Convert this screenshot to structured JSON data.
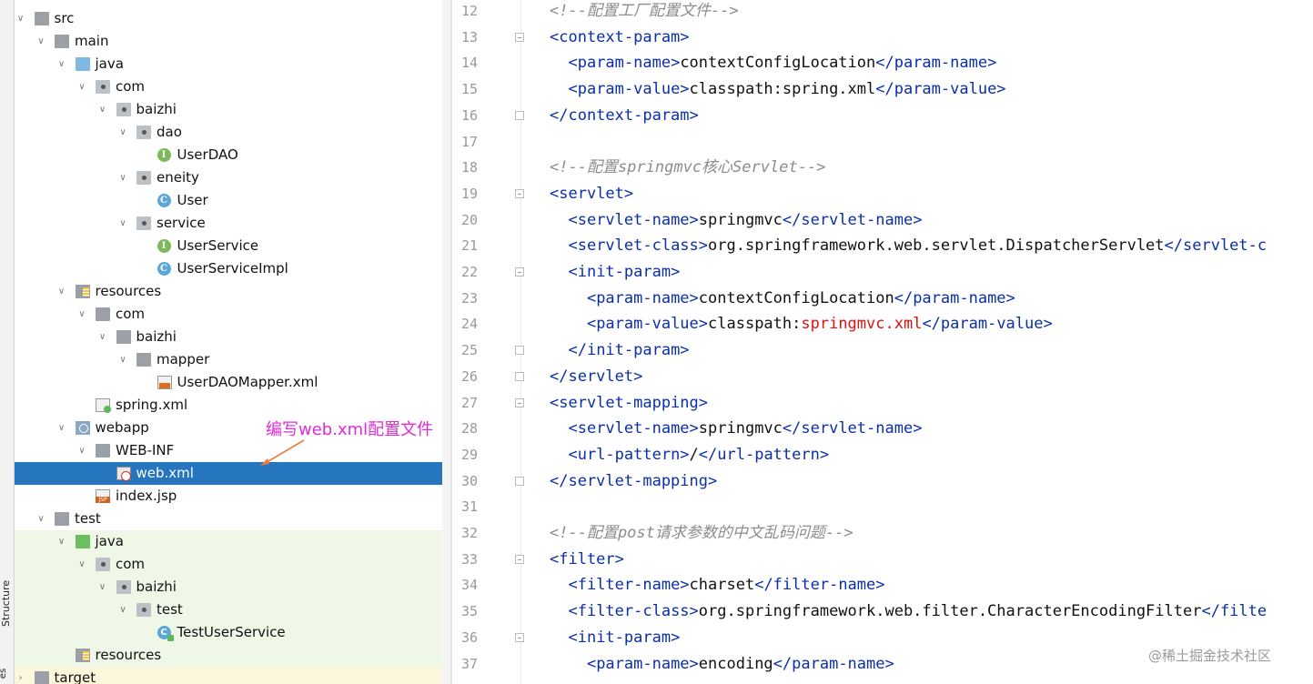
{
  "sidebar": {
    "structure_tab": "Structure",
    "bottom_tab": "es"
  },
  "tree": [
    {
      "label": "src",
      "icon": "folder-icon"
    },
    {
      "label": "main",
      "icon": "folder-icon"
    },
    {
      "label": "java",
      "icon": "source-folder-icon"
    },
    {
      "label": "com",
      "icon": "package-icon"
    },
    {
      "label": "baizhi",
      "icon": "package-icon"
    },
    {
      "label": "dao",
      "icon": "package-icon"
    },
    {
      "label": "UserDAO",
      "icon": "interface-icon"
    },
    {
      "label": "eneity",
      "icon": "package-icon"
    },
    {
      "label": "User",
      "icon": "class-icon"
    },
    {
      "label": "service",
      "icon": "package-icon"
    },
    {
      "label": "UserService",
      "icon": "interface-icon"
    },
    {
      "label": "UserServiceImpl",
      "icon": "class-icon"
    },
    {
      "label": "resources",
      "icon": "resources-folder-icon"
    },
    {
      "label": "com",
      "icon": "folder-icon"
    },
    {
      "label": "baizhi",
      "icon": "folder-icon"
    },
    {
      "label": "mapper",
      "icon": "folder-icon"
    },
    {
      "label": "UserDAOMapper.xml",
      "icon": "xml-file-icon"
    },
    {
      "label": "spring.xml",
      "icon": "spring-xml-icon"
    },
    {
      "label": "webapp",
      "icon": "web-folder-icon"
    },
    {
      "label": "WEB-INF",
      "icon": "folder-icon"
    },
    {
      "label": "web.xml",
      "icon": "web-xml-icon"
    },
    {
      "label": "index.jsp",
      "icon": "jsp-file-icon"
    },
    {
      "label": "test",
      "icon": "folder-icon"
    },
    {
      "label": "java",
      "icon": "test-source-folder-icon"
    },
    {
      "label": "com",
      "icon": "package-icon"
    },
    {
      "label": "baizhi",
      "icon": "package-icon"
    },
    {
      "label": "test",
      "icon": "package-icon"
    },
    {
      "label": "TestUserService",
      "icon": "test-class-icon"
    },
    {
      "label": "resources",
      "icon": "resources-folder-icon"
    },
    {
      "label": "target",
      "icon": "excluded-folder-icon"
    }
  ],
  "annotation": {
    "text": "编写web.xml配置文件",
    "color": "#e22bd7"
  },
  "editor": {
    "lines": [
      {
        "n": "12",
        "segs": [
          {
            "t": "<!--配置工厂配置文件-->",
            "c": "cm"
          }
        ]
      },
      {
        "n": "13",
        "segs": [
          {
            "t": "<context-param>",
            "c": "tg"
          }
        ]
      },
      {
        "n": "14",
        "segs": [
          {
            "t": "  "
          },
          {
            "t": "<param-name>",
            "c": "tg"
          },
          {
            "t": "contextConfigLocation"
          },
          {
            "t": "</param-name>",
            "c": "tg"
          }
        ]
      },
      {
        "n": "15",
        "segs": [
          {
            "t": "  "
          },
          {
            "t": "<param-value>",
            "c": "tg"
          },
          {
            "t": "classpath:spring.xml"
          },
          {
            "t": "</param-value>",
            "c": "tg"
          }
        ]
      },
      {
        "n": "16",
        "segs": [
          {
            "t": "</context-param>",
            "c": "tg"
          }
        ]
      },
      {
        "n": "17",
        "segs": []
      },
      {
        "n": "18",
        "segs": [
          {
            "t": "<!--配置springmvc核心Servlet-->",
            "c": "cm"
          }
        ]
      },
      {
        "n": "19",
        "segs": [
          {
            "t": "<servlet>",
            "c": "tg"
          }
        ]
      },
      {
        "n": "20",
        "segs": [
          {
            "t": "  "
          },
          {
            "t": "<servlet-name>",
            "c": "tg"
          },
          {
            "t": "springmvc"
          },
          {
            "t": "</servlet-name>",
            "c": "tg"
          }
        ]
      },
      {
        "n": "21",
        "segs": [
          {
            "t": "  "
          },
          {
            "t": "<servlet-class>",
            "c": "tg"
          },
          {
            "t": "org.springframework.web.servlet.DispatcherServlet"
          },
          {
            "t": "</servlet-c",
            "c": "tg"
          }
        ]
      },
      {
        "n": "22",
        "segs": [
          {
            "t": "  "
          },
          {
            "t": "<init-param>",
            "c": "tg"
          }
        ]
      },
      {
        "n": "23",
        "segs": [
          {
            "t": "    "
          },
          {
            "t": "<param-name>",
            "c": "tg"
          },
          {
            "t": "contextConfigLocation"
          },
          {
            "t": "</param-name>",
            "c": "tg"
          }
        ]
      },
      {
        "n": "24",
        "segs": [
          {
            "t": "    "
          },
          {
            "t": "<param-value>",
            "c": "tg"
          },
          {
            "t": "classpath:"
          },
          {
            "t": "springmvc.xml",
            "c": "rd"
          },
          {
            "t": "</param-value>",
            "c": "tg"
          }
        ]
      },
      {
        "n": "25",
        "segs": [
          {
            "t": "  "
          },
          {
            "t": "</init-param>",
            "c": "tg"
          }
        ]
      },
      {
        "n": "26",
        "segs": [
          {
            "t": "</servlet>",
            "c": "tg"
          }
        ]
      },
      {
        "n": "27",
        "segs": [
          {
            "t": "<servlet-mapping>",
            "c": "tg"
          }
        ]
      },
      {
        "n": "28",
        "segs": [
          {
            "t": "  "
          },
          {
            "t": "<servlet-name>",
            "c": "tg"
          },
          {
            "t": "springmvc"
          },
          {
            "t": "</servlet-name>",
            "c": "tg"
          }
        ]
      },
      {
        "n": "29",
        "segs": [
          {
            "t": "  "
          },
          {
            "t": "<url-pattern>",
            "c": "tg"
          },
          {
            "t": "/"
          },
          {
            "t": "</url-pattern>",
            "c": "tg"
          }
        ]
      },
      {
        "n": "30",
        "segs": [
          {
            "t": "</servlet-mapping>",
            "c": "tg"
          }
        ]
      },
      {
        "n": "31",
        "segs": []
      },
      {
        "n": "32",
        "segs": [
          {
            "t": "<!--配置post请求参数的中文乱码问题-->",
            "c": "cm"
          }
        ]
      },
      {
        "n": "33",
        "segs": [
          {
            "t": "<filter>",
            "c": "tg"
          }
        ]
      },
      {
        "n": "34",
        "segs": [
          {
            "t": "  "
          },
          {
            "t": "<filter-name>",
            "c": "tg"
          },
          {
            "t": "charset"
          },
          {
            "t": "</filter-name>",
            "c": "tg"
          }
        ]
      },
      {
        "n": "35",
        "segs": [
          {
            "t": "  "
          },
          {
            "t": "<filter-class>",
            "c": "tg"
          },
          {
            "t": "org.springframework.web.filter.CharacterEncodingFilter"
          },
          {
            "t": "</filte",
            "c": "tg"
          }
        ]
      },
      {
        "n": "36",
        "segs": [
          {
            "t": "  "
          },
          {
            "t": "<init-param>",
            "c": "tg"
          }
        ]
      },
      {
        "n": "37",
        "segs": [
          {
            "t": "    "
          },
          {
            "t": "<param-name>",
            "c": "tg"
          },
          {
            "t": "encoding"
          },
          {
            "t": "</param-name>",
            "c": "tg"
          }
        ]
      }
    ]
  },
  "watermark": "@稀土掘金技术社区"
}
